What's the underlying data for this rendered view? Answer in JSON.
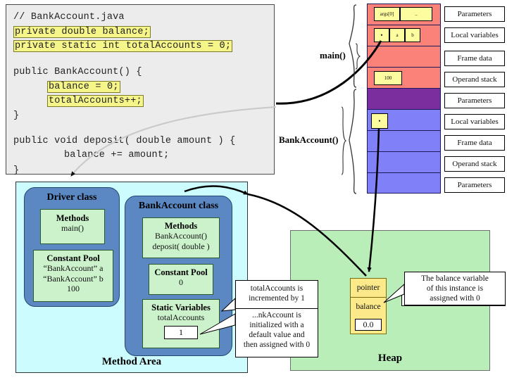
{
  "code_panel": {
    "lines": [
      {
        "text": "// BankAccount.java",
        "highlight": false
      },
      {
        "text": "private double balance;",
        "highlight": true
      },
      {
        "text": "private static int totalAccounts = 0;",
        "highlight": true
      },
      {
        "text": "public BankAccount() {",
        "highlight": false
      },
      {
        "text": "balance = 0;",
        "highlight": true
      },
      {
        "text": "totalAccounts++;",
        "highlight": true
      },
      {
        "text": "}",
        "highlight": false
      },
      {
        "text": "public void deposit( double amount ) {",
        "highlight": false
      },
      {
        "text": "balance += amount;",
        "highlight": false
      },
      {
        "text": "}",
        "highlight": false
      }
    ]
  },
  "stack": {
    "frames": [
      {
        "name": "main()",
        "color": "#fb8279"
      },
      {
        "name": "BankAccount()",
        "color": "#8080f8"
      }
    ],
    "rows": [
      {
        "label": "Parameters",
        "color": "c-red"
      },
      {
        "label": "Local variables",
        "color": "c-red"
      },
      {
        "label": "Frame data",
        "color": "c-red"
      },
      {
        "label": "Operand stack",
        "color": "c-red"
      },
      {
        "label": "Parameters",
        "color": "c-purple"
      },
      {
        "label": "Local variables",
        "color": "c-blue"
      },
      {
        "label": "Frame data",
        "color": "c-blue"
      },
      {
        "label": "Operand stack",
        "color": "c-blue"
      },
      {
        "label": "Parameters",
        "color": "c-blue"
      }
    ],
    "cells": {
      "params_args": "args[0]",
      "params_dots": "..",
      "local_ref": "•",
      "local_a": "a",
      "local_b": "b",
      "operand_100": "100",
      "ctor_local_ref": "•"
    }
  },
  "method_area": {
    "title": "Method Area",
    "driver_class": {
      "title": "Driver class",
      "methods_header": "Methods",
      "methods_body": "main()",
      "pool_header": "Constant Pool",
      "pool_line1": "“BankAccount” a",
      "pool_line2": "“BankAccount” b",
      "pool_line3": "100"
    },
    "bank_class": {
      "title": "BankAccount class",
      "methods_header": "Methods",
      "methods_line1": "BankAccount()",
      "methods_line2": "deposit( double )",
      "pool_header": "Constant Pool",
      "pool_value": "0",
      "static_header": "Static Variables",
      "static_name": "totalAccounts",
      "static_value": "1"
    }
  },
  "heap": {
    "title": "Heap",
    "object": {
      "pointer_label": "pointer",
      "balance_label": "balance",
      "balance_value": "0.0"
    }
  },
  "callouts": {
    "total_accounts": "totalAccounts is\nincremented by 1",
    "initialized": "...nkAccount is\ninitialized with a\ndefault value and\nthen assigned with 0",
    "balance_var": "The balance variable\nof this instance is\nassigned with 0",
    "default_value": "default value"
  },
  "colors": {
    "code_bg": "#ececec",
    "highlight": "#f5f58a",
    "frame_main": "#fb8279",
    "frame_params_purple": "#7b2f9e",
    "frame_ctor": "#8080f8",
    "method_area_bg": "#ccfcfd",
    "class_box": "#5b87c2",
    "inner_box": "#ccf2cc",
    "heap_bg": "#b9eeb9",
    "object_bg": "#fbe98a"
  }
}
